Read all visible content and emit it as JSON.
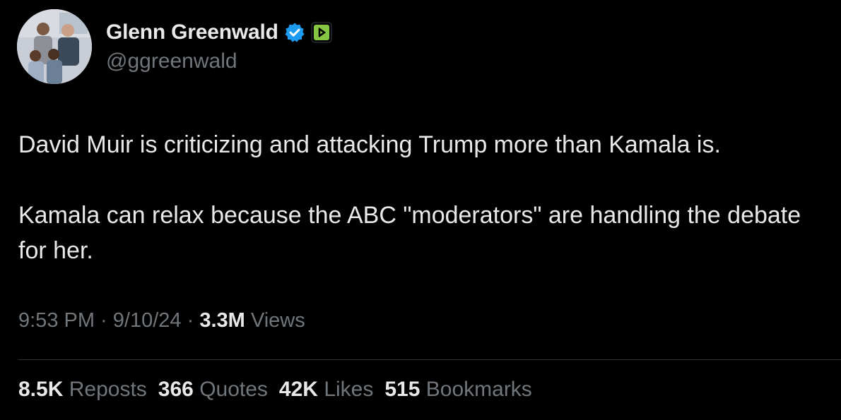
{
  "author": {
    "display_name": "Glenn Greenwald",
    "handle": "@ggreenwald",
    "verified_badge_icon": "verified-check-icon",
    "extra_badge_icon": "rumble-play-icon",
    "verified_color": "#1d9bf0",
    "extra_badge_color": "#85c742"
  },
  "tweet": {
    "paragraphs": [
      "David Muir is criticizing and attacking Trump more than Kamala is.",
      "Kamala can relax because the ABC \"moderators\" are handling the debate for her."
    ]
  },
  "meta": {
    "time": "9:53 PM",
    "sep1": " · ",
    "date": "9/10/24",
    "sep2": " · ",
    "views_count": "3.3M",
    "views_label": " Views"
  },
  "stats": [
    {
      "count": "8.5K",
      "label": "Reposts"
    },
    {
      "count": "366",
      "label": "Quotes"
    },
    {
      "count": "42K",
      "label": "Likes"
    },
    {
      "count": "515",
      "label": "Bookmarks"
    }
  ],
  "colors": {
    "background": "#000000",
    "primary_text": "#e7e9ea",
    "secondary_text": "#71767b",
    "divider": "#2f3336"
  }
}
